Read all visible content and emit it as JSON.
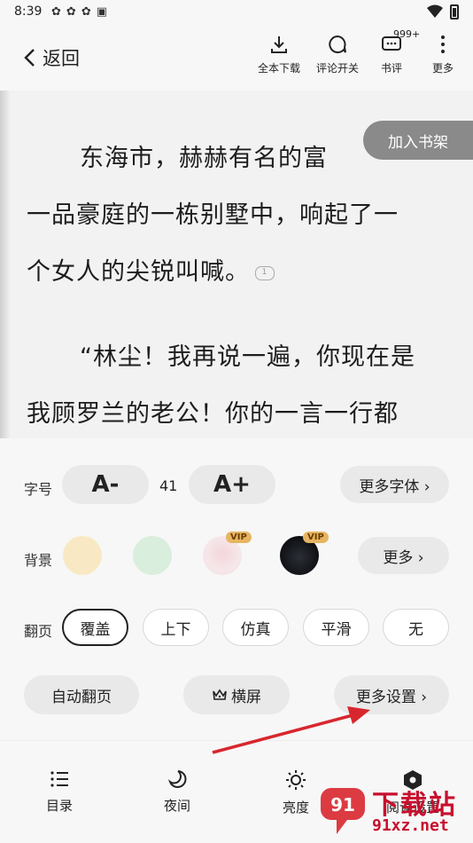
{
  "status_bar": {
    "time": "8:39",
    "icons": [
      "app-icon",
      "app-icon",
      "app-icon",
      "a-icon"
    ]
  },
  "top_bar": {
    "back_label": "返回",
    "actions": [
      {
        "label": "全本下载",
        "icon": "download-icon"
      },
      {
        "label": "评论开关",
        "icon": "comment-toggle-icon"
      },
      {
        "label": "书评",
        "icon": "review-icon",
        "badge": "999+"
      },
      {
        "label": "更多",
        "icon": "more-vertical-icon"
      }
    ]
  },
  "reader": {
    "lines": [
      "东海市，赫赫有名的富",
      "一品豪庭的一栋别墅中，响起了一",
      "个女人的尖锐叫喊。",
      "“林尘！我再说一遍，你现在是",
      "我顾罗兰的老公！你的一言一行都"
    ],
    "comment_count": "1",
    "add_to_shelf": "加入书架"
  },
  "settings": {
    "font_size": {
      "label": "字号",
      "decrease": "A-",
      "increase": "A+",
      "value": "41",
      "more_fonts": "更多字体 ›"
    },
    "background": {
      "label": "背景",
      "vip_badge": "VIP",
      "more": "更多 ›",
      "colors": [
        "#f8e9c4",
        "#d9eedd"
      ]
    },
    "page_turn": {
      "label": "翻页",
      "options": [
        "覆盖",
        "上下",
        "仿真",
        "平滑",
        "无"
      ],
      "selected": "覆盖"
    },
    "auto_page": "自动翻页",
    "landscape": "横屏",
    "more_settings": "更多设置 ›"
  },
  "bottom_nav": [
    {
      "label": "目录",
      "icon": "list-icon"
    },
    {
      "label": "夜间",
      "icon": "moon-icon"
    },
    {
      "label": "亮度",
      "icon": "brightness-icon"
    },
    {
      "label": "阅读设置",
      "icon": "settings-hex-icon"
    }
  ],
  "watermark": {
    "top": "下载站",
    "bottom": "91xz.net"
  },
  "colors": {
    "accent": "#222222",
    "annotation": "#d8262e",
    "panel": "#f7f7f7"
  }
}
